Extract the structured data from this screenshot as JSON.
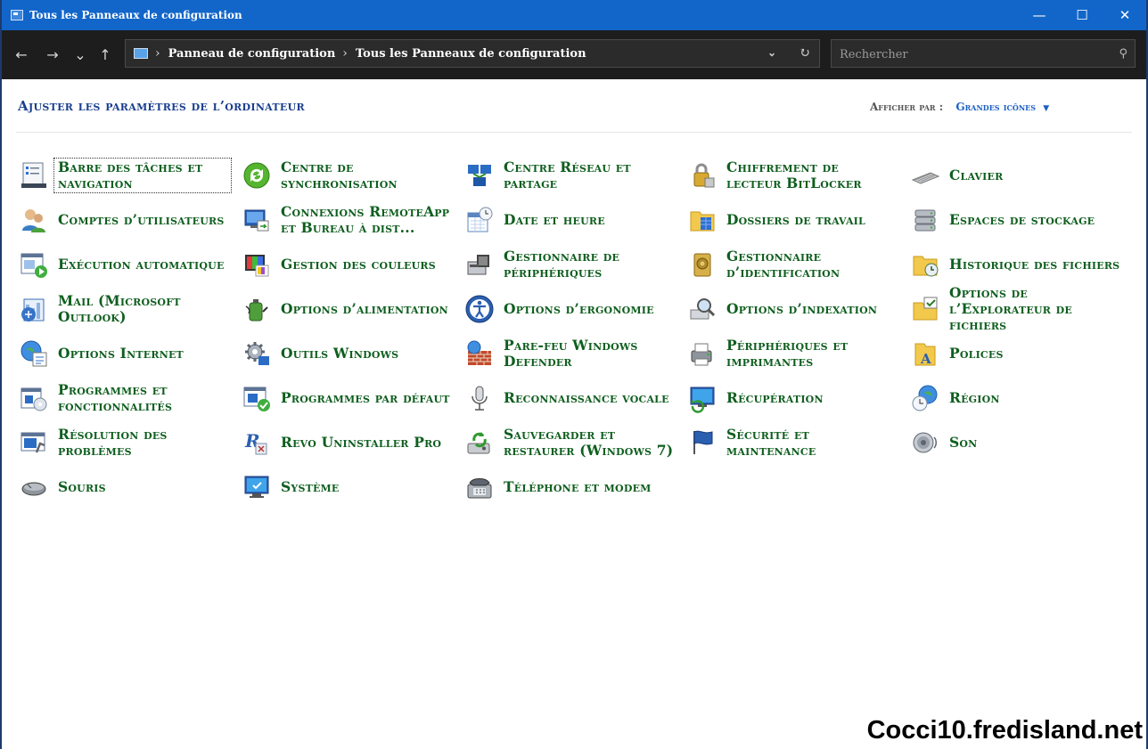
{
  "window": {
    "title": "Tous les Panneaux de configuration",
    "minimize": "—",
    "maximize": "☐",
    "close": "✕"
  },
  "nav": {
    "back": "←",
    "forward": "→",
    "recent": "⌄",
    "up": "↑",
    "breadcrumb": [
      "Panneau de configuration",
      "Tous les Panneaux de configuration"
    ],
    "search_placeholder": "Rechercher"
  },
  "header": {
    "heading": "Ajuster les paramètres de l’ordinateur",
    "view_by_label": "Afficher par :",
    "view_by_value": "Grandes icônes"
  },
  "items": [
    {
      "label": "Barre des tâches et navigation",
      "icon": "taskbar-icon"
    },
    {
      "label": "Centre de synchronisation",
      "icon": "sync-center-icon"
    },
    {
      "label": "Centre Réseau et partage",
      "icon": "network-icon"
    },
    {
      "label": "Chiffrement de lecteur BitLocker",
      "icon": "bitlocker-icon"
    },
    {
      "label": "Clavier",
      "icon": "keyboard-icon"
    },
    {
      "label": "Comptes d’utilisateurs",
      "icon": "user-accounts-icon"
    },
    {
      "label": "Connexions RemoteApp et Bureau à dist...",
      "icon": "remoteapp-icon"
    },
    {
      "label": "Date et heure",
      "icon": "date-time-icon"
    },
    {
      "label": "Dossiers de travail",
      "icon": "work-folders-icon"
    },
    {
      "label": "Espaces de stockage",
      "icon": "storage-spaces-icon"
    },
    {
      "label": "Exécution automatique",
      "icon": "autoplay-icon"
    },
    {
      "label": "Gestion des couleurs",
      "icon": "color-management-icon"
    },
    {
      "label": "Gestionnaire de périphériques",
      "icon": "device-manager-icon"
    },
    {
      "label": "Gestionnaire d’identification",
      "icon": "credential-manager-icon"
    },
    {
      "label": "Historique des fichiers",
      "icon": "file-history-icon"
    },
    {
      "label": "Mail (Microsoft Outlook)",
      "icon": "mail-icon"
    },
    {
      "label": "Options d’alimentation",
      "icon": "power-options-icon"
    },
    {
      "label": "Options d’ergonomie",
      "icon": "ease-of-access-icon"
    },
    {
      "label": "Options d’indexation",
      "icon": "indexing-icon"
    },
    {
      "label": "Options de l’Explorateur de fichiers",
      "icon": "file-explorer-options-icon"
    },
    {
      "label": "Options Internet",
      "icon": "internet-options-icon"
    },
    {
      "label": "Outils Windows",
      "icon": "windows-tools-icon"
    },
    {
      "label": "Pare-feu Windows Defender",
      "icon": "firewall-icon"
    },
    {
      "label": "Périphériques et imprimantes",
      "icon": "devices-printers-icon"
    },
    {
      "label": "Polices",
      "icon": "fonts-icon"
    },
    {
      "label": "Programmes et fonctionnalités",
      "icon": "programs-features-icon"
    },
    {
      "label": "Programmes par défaut",
      "icon": "default-programs-icon"
    },
    {
      "label": "Reconnaissance vocale",
      "icon": "speech-recognition-icon"
    },
    {
      "label": "Récupération",
      "icon": "recovery-icon"
    },
    {
      "label": "Région",
      "icon": "region-icon"
    },
    {
      "label": "Résolution des problèmes",
      "icon": "troubleshooting-icon"
    },
    {
      "label": "Revo Uninstaller Pro",
      "icon": "revo-uninstaller-icon"
    },
    {
      "label": "Sauvegarder et restaurer (Windows 7)",
      "icon": "backup-restore-icon"
    },
    {
      "label": "Sécurité et maintenance",
      "icon": "security-maintenance-icon"
    },
    {
      "label": "Son",
      "icon": "sound-icon"
    },
    {
      "label": "Souris",
      "icon": "mouse-icon"
    },
    {
      "label": "Système",
      "icon": "system-icon"
    },
    {
      "label": "Téléphone et modem",
      "icon": "phone-modem-icon"
    }
  ],
  "watermark": "Cocci10.fredisland.net"
}
